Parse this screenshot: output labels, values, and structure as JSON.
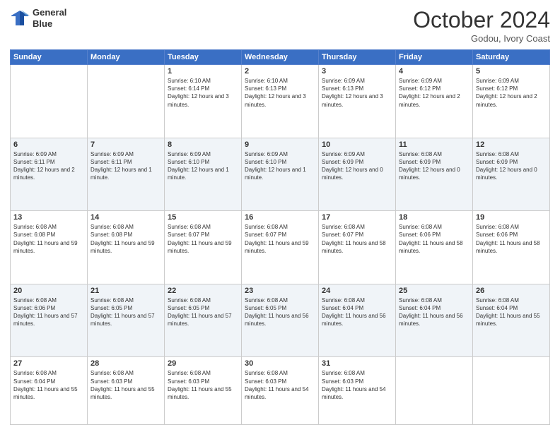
{
  "logo": {
    "line1": "General",
    "line2": "Blue"
  },
  "title": "October 2024",
  "location": "Godou, Ivory Coast",
  "days_of_week": [
    "Sunday",
    "Monday",
    "Tuesday",
    "Wednesday",
    "Thursday",
    "Friday",
    "Saturday"
  ],
  "weeks": [
    [
      {
        "day": "",
        "info": ""
      },
      {
        "day": "",
        "info": ""
      },
      {
        "day": "1",
        "info": "Sunrise: 6:10 AM\nSunset: 6:14 PM\nDaylight: 12 hours and 3 minutes."
      },
      {
        "day": "2",
        "info": "Sunrise: 6:10 AM\nSunset: 6:13 PM\nDaylight: 12 hours and 3 minutes."
      },
      {
        "day": "3",
        "info": "Sunrise: 6:09 AM\nSunset: 6:13 PM\nDaylight: 12 hours and 3 minutes."
      },
      {
        "day": "4",
        "info": "Sunrise: 6:09 AM\nSunset: 6:12 PM\nDaylight: 12 hours and 2 minutes."
      },
      {
        "day": "5",
        "info": "Sunrise: 6:09 AM\nSunset: 6:12 PM\nDaylight: 12 hours and 2 minutes."
      }
    ],
    [
      {
        "day": "6",
        "info": "Sunrise: 6:09 AM\nSunset: 6:11 PM\nDaylight: 12 hours and 2 minutes."
      },
      {
        "day": "7",
        "info": "Sunrise: 6:09 AM\nSunset: 6:11 PM\nDaylight: 12 hours and 1 minute."
      },
      {
        "day": "8",
        "info": "Sunrise: 6:09 AM\nSunset: 6:10 PM\nDaylight: 12 hours and 1 minute."
      },
      {
        "day": "9",
        "info": "Sunrise: 6:09 AM\nSunset: 6:10 PM\nDaylight: 12 hours and 1 minute."
      },
      {
        "day": "10",
        "info": "Sunrise: 6:09 AM\nSunset: 6:09 PM\nDaylight: 12 hours and 0 minutes."
      },
      {
        "day": "11",
        "info": "Sunrise: 6:08 AM\nSunset: 6:09 PM\nDaylight: 12 hours and 0 minutes."
      },
      {
        "day": "12",
        "info": "Sunrise: 6:08 AM\nSunset: 6:09 PM\nDaylight: 12 hours and 0 minutes."
      }
    ],
    [
      {
        "day": "13",
        "info": "Sunrise: 6:08 AM\nSunset: 6:08 PM\nDaylight: 11 hours and 59 minutes."
      },
      {
        "day": "14",
        "info": "Sunrise: 6:08 AM\nSunset: 6:08 PM\nDaylight: 11 hours and 59 minutes."
      },
      {
        "day": "15",
        "info": "Sunrise: 6:08 AM\nSunset: 6:07 PM\nDaylight: 11 hours and 59 minutes."
      },
      {
        "day": "16",
        "info": "Sunrise: 6:08 AM\nSunset: 6:07 PM\nDaylight: 11 hours and 59 minutes."
      },
      {
        "day": "17",
        "info": "Sunrise: 6:08 AM\nSunset: 6:07 PM\nDaylight: 11 hours and 58 minutes."
      },
      {
        "day": "18",
        "info": "Sunrise: 6:08 AM\nSunset: 6:06 PM\nDaylight: 11 hours and 58 minutes."
      },
      {
        "day": "19",
        "info": "Sunrise: 6:08 AM\nSunset: 6:06 PM\nDaylight: 11 hours and 58 minutes."
      }
    ],
    [
      {
        "day": "20",
        "info": "Sunrise: 6:08 AM\nSunset: 6:06 PM\nDaylight: 11 hours and 57 minutes."
      },
      {
        "day": "21",
        "info": "Sunrise: 6:08 AM\nSunset: 6:05 PM\nDaylight: 11 hours and 57 minutes."
      },
      {
        "day": "22",
        "info": "Sunrise: 6:08 AM\nSunset: 6:05 PM\nDaylight: 11 hours and 57 minutes."
      },
      {
        "day": "23",
        "info": "Sunrise: 6:08 AM\nSunset: 6:05 PM\nDaylight: 11 hours and 56 minutes."
      },
      {
        "day": "24",
        "info": "Sunrise: 6:08 AM\nSunset: 6:04 PM\nDaylight: 11 hours and 56 minutes."
      },
      {
        "day": "25",
        "info": "Sunrise: 6:08 AM\nSunset: 6:04 PM\nDaylight: 11 hours and 56 minutes."
      },
      {
        "day": "26",
        "info": "Sunrise: 6:08 AM\nSunset: 6:04 PM\nDaylight: 11 hours and 55 minutes."
      }
    ],
    [
      {
        "day": "27",
        "info": "Sunrise: 6:08 AM\nSunset: 6:04 PM\nDaylight: 11 hours and 55 minutes."
      },
      {
        "day": "28",
        "info": "Sunrise: 6:08 AM\nSunset: 6:03 PM\nDaylight: 11 hours and 55 minutes."
      },
      {
        "day": "29",
        "info": "Sunrise: 6:08 AM\nSunset: 6:03 PM\nDaylight: 11 hours and 55 minutes."
      },
      {
        "day": "30",
        "info": "Sunrise: 6:08 AM\nSunset: 6:03 PM\nDaylight: 11 hours and 54 minutes."
      },
      {
        "day": "31",
        "info": "Sunrise: 6:08 AM\nSunset: 6:03 PM\nDaylight: 11 hours and 54 minutes."
      },
      {
        "day": "",
        "info": ""
      },
      {
        "day": "",
        "info": ""
      }
    ]
  ]
}
